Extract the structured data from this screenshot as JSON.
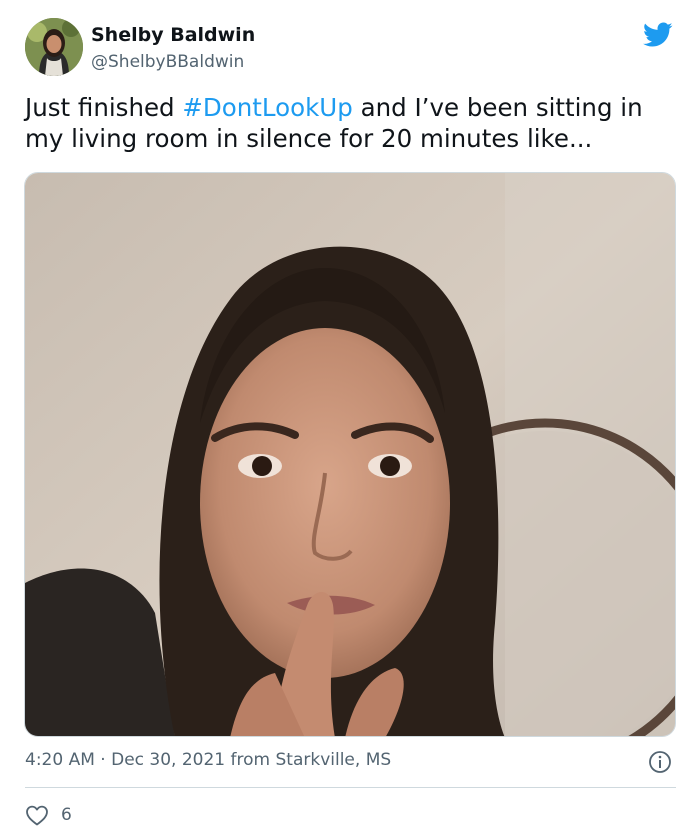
{
  "author": {
    "name": "Shelby Baldwin",
    "handle": "@ShelbyBBaldwin"
  },
  "tweet": {
    "text_before": "Just finished ",
    "hashtag": "#DontLookUp",
    "text_after": " and I’ve been sitting in my living room in silence for 20 minutes like..."
  },
  "meta": {
    "time": "4:20 AM",
    "separator": " · ",
    "date": "Dec 30, 2021",
    "location": " from Starkville, MS"
  },
  "engagement": {
    "likes": "6"
  },
  "icons": {
    "brand": "twitter-bird-icon",
    "info": "info-icon",
    "like": "heart-icon"
  },
  "colors": {
    "brand_blue": "#1d9bf0",
    "text_primary": "#0f1419",
    "text_secondary": "#536471",
    "border": "#cfd9de"
  }
}
